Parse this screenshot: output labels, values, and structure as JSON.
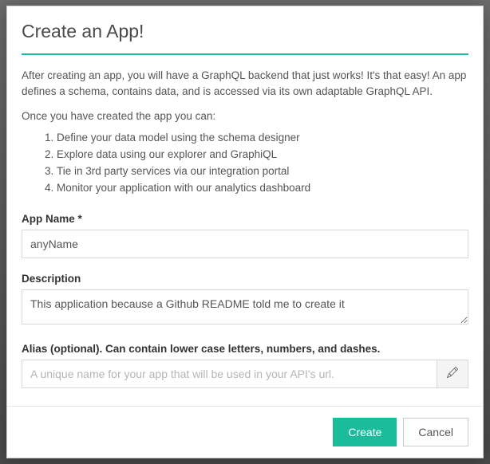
{
  "modal": {
    "title": "Create an App!",
    "intro": "After creating an app, you will have a GraphQL backend that just works! It's that easy! An app defines a schema, contains data, and is accessed via its own adaptable GraphQL API.",
    "after_list_label": "Once you have created the app you can:",
    "steps": [
      "Define your data model using the schema designer",
      "Explore data using our explorer and GraphiQL",
      "Tie in 3rd party services via our integration portal",
      "Monitor your application with our analytics dashboard"
    ],
    "fields": {
      "app_name": {
        "label": "App Name *",
        "value": "anyName"
      },
      "description": {
        "label": "Description",
        "value": "This application because a Github README told me to create it"
      },
      "alias": {
        "label": "Alias (optional). Can contain lower case letters, numbers, and dashes.",
        "placeholder": "A unique name for your app that will be used in your API's url."
      }
    },
    "buttons": {
      "create": "Create",
      "cancel": "Cancel"
    }
  }
}
